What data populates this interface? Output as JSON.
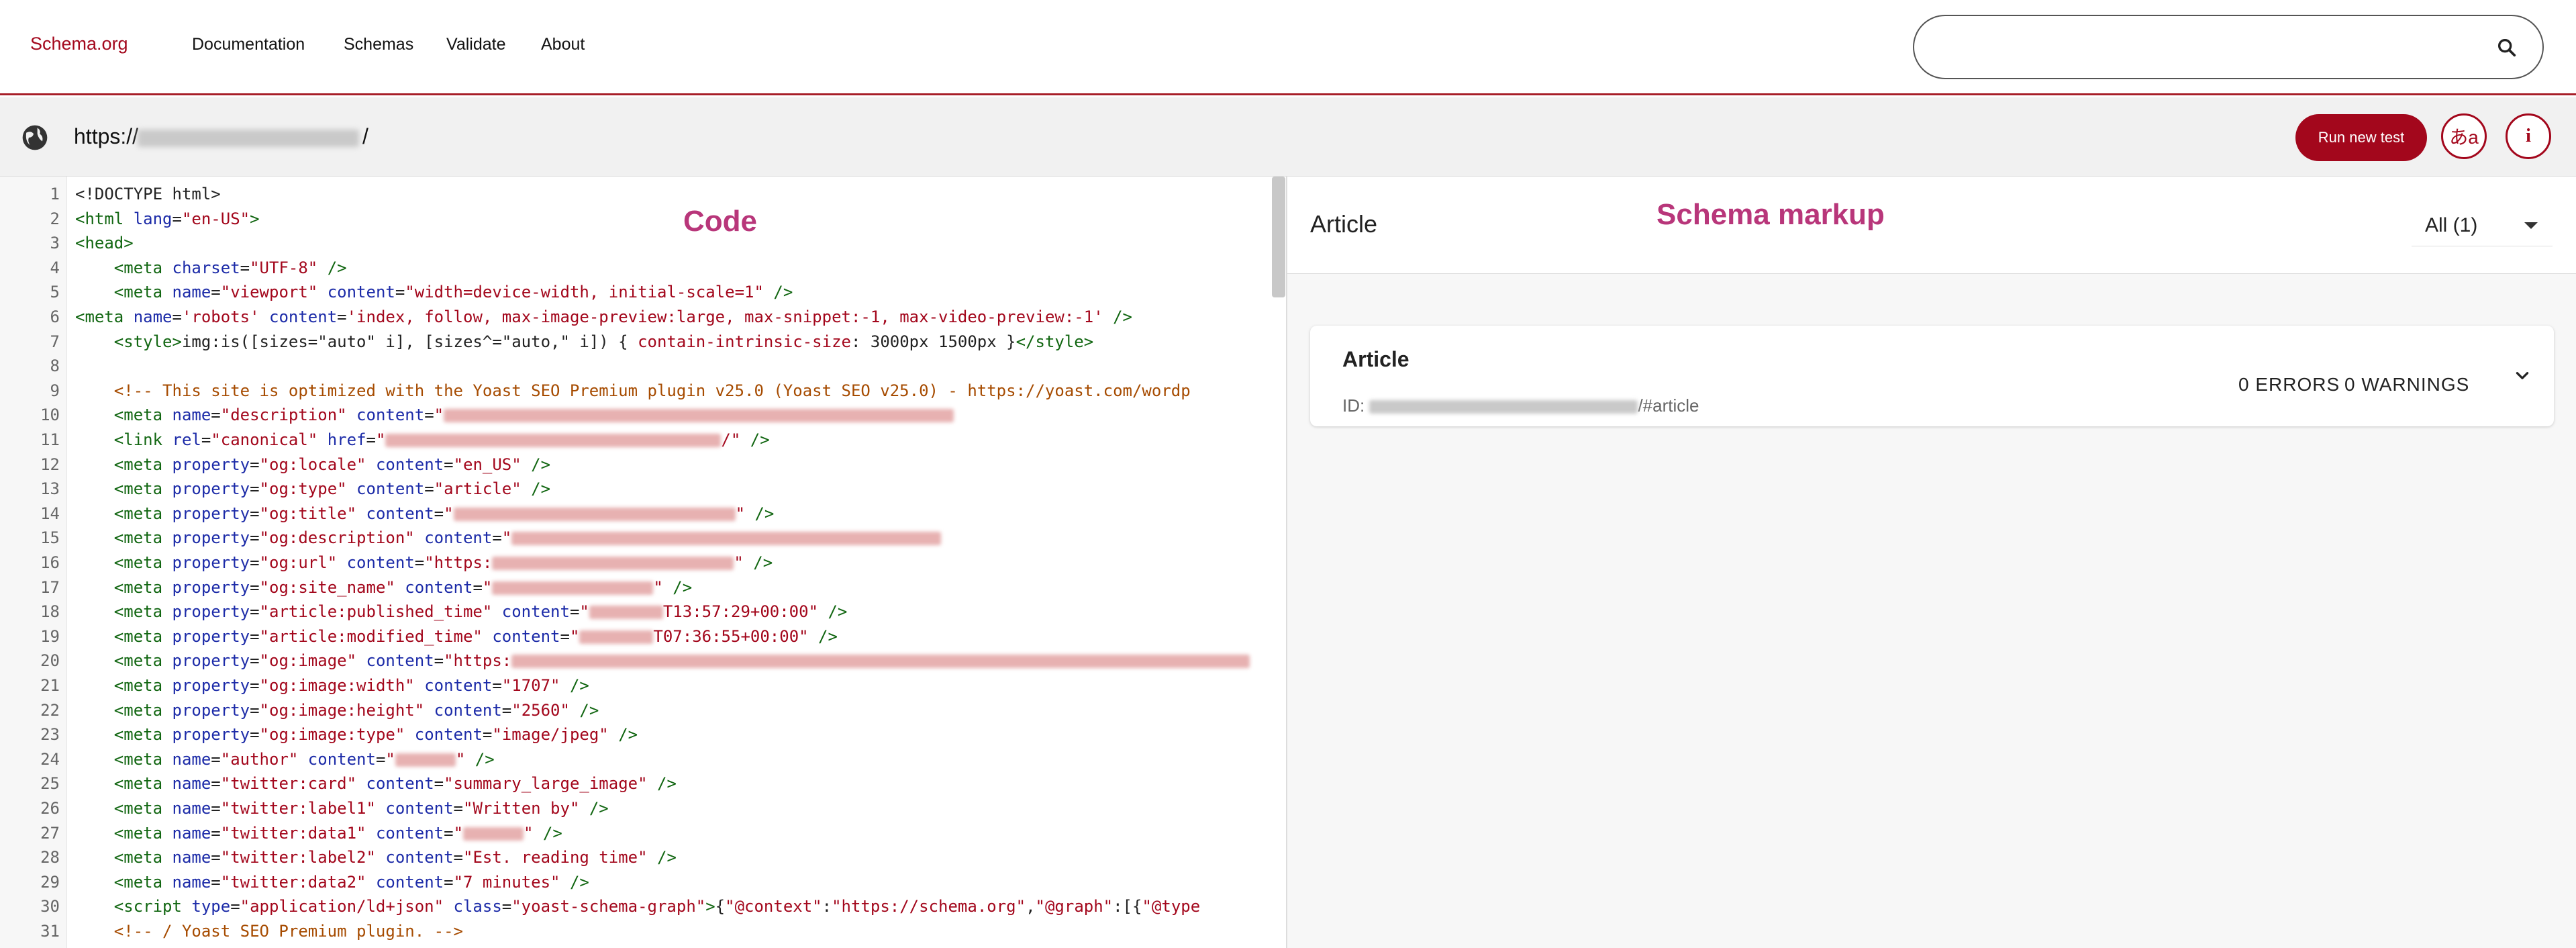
{
  "nav": {
    "logo": "Schema.org",
    "links": [
      "Documentation",
      "Schemas",
      "Validate",
      "About"
    ]
  },
  "urlbar": {
    "prefix": "https://",
    "suffix": "/",
    "run_label": "Run new test",
    "lang_label": "あa",
    "info_label": "i"
  },
  "code": {
    "panel_label": "Code",
    "lines": [
      [
        [
          "t",
          "<!DOCTYPE html>"
        ]
      ],
      [
        [
          "g",
          "<html "
        ],
        [
          "a",
          "lang"
        ],
        [
          "t",
          "="
        ],
        [
          "s",
          "\"en-US\""
        ],
        [
          "g",
          ">"
        ]
      ],
      [
        [
          "g",
          "<head>"
        ]
      ],
      [
        [
          "t",
          "    "
        ],
        [
          "g",
          "<meta "
        ],
        [
          "a",
          "charset"
        ],
        [
          "t",
          "="
        ],
        [
          "s",
          "\"UTF-8\""
        ],
        [
          "g",
          " />"
        ]
      ],
      [
        [
          "t",
          "    "
        ],
        [
          "g",
          "<meta "
        ],
        [
          "a",
          "name"
        ],
        [
          "t",
          "="
        ],
        [
          "s",
          "\"viewport\""
        ],
        [
          "t",
          " "
        ],
        [
          "a",
          "content"
        ],
        [
          "t",
          "="
        ],
        [
          "s",
          "\"width=device-width, initial-scale=1\""
        ],
        [
          "g",
          " />"
        ]
      ],
      [
        [
          "g",
          "<meta "
        ],
        [
          "a",
          "name"
        ],
        [
          "t",
          "="
        ],
        [
          "s",
          "'robots'"
        ],
        [
          "t",
          " "
        ],
        [
          "a",
          "content"
        ],
        [
          "t",
          "="
        ],
        [
          "s",
          "'index, follow, max-image-preview:large, max-snippet:-1, max-video-preview:-1'"
        ],
        [
          "g",
          " />"
        ]
      ],
      [
        [
          "t",
          "    "
        ],
        [
          "g",
          "<style>"
        ],
        [
          "t",
          "img:is([sizes=\"auto\" i], [sizes^=\"auto,\" i]) { "
        ],
        [
          "s",
          "contain-intrinsic-size"
        ],
        [
          "t",
          ": 3000px 1500px }"
        ],
        [
          "g",
          "</style>"
        ]
      ],
      [],
      [
        [
          "t",
          "    "
        ],
        [
          "c",
          "<!-- This site is optimized with the Yoast SEO Premium plugin v25.0 (Yoast SEO v25.0) - https://yoast.com/wordp"
        ]
      ],
      [
        [
          "t",
          "    "
        ],
        [
          "g",
          "<meta "
        ],
        [
          "a",
          "name"
        ],
        [
          "t",
          "="
        ],
        [
          "s",
          "\"description\""
        ],
        [
          "t",
          " "
        ],
        [
          "a",
          "content"
        ],
        [
          "t",
          "="
        ],
        [
          "s",
          "\""
        ],
        [
          "b",
          "760"
        ]
      ],
      [
        [
          "t",
          "    "
        ],
        [
          "g",
          "<link "
        ],
        [
          "a",
          "rel"
        ],
        [
          "t",
          "="
        ],
        [
          "s",
          "\"canonical\""
        ],
        [
          "t",
          " "
        ],
        [
          "a",
          "href"
        ],
        [
          "t",
          "="
        ],
        [
          "s",
          "\""
        ],
        [
          "b",
          "500"
        ],
        [
          "s",
          "/\""
        ],
        [
          "g",
          " />"
        ]
      ],
      [
        [
          "t",
          "    "
        ],
        [
          "g",
          "<meta "
        ],
        [
          "a",
          "property"
        ],
        [
          "t",
          "="
        ],
        [
          "s",
          "\"og:locale\""
        ],
        [
          "t",
          " "
        ],
        [
          "a",
          "content"
        ],
        [
          "t",
          "="
        ],
        [
          "s",
          "\"en_US\""
        ],
        [
          "g",
          " />"
        ]
      ],
      [
        [
          "t",
          "    "
        ],
        [
          "g",
          "<meta "
        ],
        [
          "a",
          "property"
        ],
        [
          "t",
          "="
        ],
        [
          "s",
          "\"og:type\""
        ],
        [
          "t",
          " "
        ],
        [
          "a",
          "content"
        ],
        [
          "t",
          "="
        ],
        [
          "s",
          "\"article\""
        ],
        [
          "g",
          " />"
        ]
      ],
      [
        [
          "t",
          "    "
        ],
        [
          "g",
          "<meta "
        ],
        [
          "a",
          "property"
        ],
        [
          "t",
          "="
        ],
        [
          "s",
          "\"og:title\""
        ],
        [
          "t",
          " "
        ],
        [
          "a",
          "content"
        ],
        [
          "t",
          "="
        ],
        [
          "s",
          "\""
        ],
        [
          "b",
          "420"
        ],
        [
          "s",
          "\""
        ],
        [
          "g",
          " />"
        ]
      ],
      [
        [
          "t",
          "    "
        ],
        [
          "g",
          "<meta "
        ],
        [
          "a",
          "property"
        ],
        [
          "t",
          "="
        ],
        [
          "s",
          "\"og:description\""
        ],
        [
          "t",
          " "
        ],
        [
          "a",
          "content"
        ],
        [
          "t",
          "="
        ],
        [
          "s",
          "\""
        ],
        [
          "b",
          "640"
        ]
      ],
      [
        [
          "t",
          "    "
        ],
        [
          "g",
          "<meta "
        ],
        [
          "a",
          "property"
        ],
        [
          "t",
          "="
        ],
        [
          "s",
          "\"og:url\""
        ],
        [
          "t",
          " "
        ],
        [
          "a",
          "content"
        ],
        [
          "t",
          "="
        ],
        [
          "s",
          "\"https:"
        ],
        [
          "b",
          "360"
        ],
        [
          "s",
          "\""
        ],
        [
          "g",
          " />"
        ]
      ],
      [
        [
          "t",
          "    "
        ],
        [
          "g",
          "<meta "
        ],
        [
          "a",
          "property"
        ],
        [
          "t",
          "="
        ],
        [
          "s",
          "\"og:site_name\""
        ],
        [
          "t",
          " "
        ],
        [
          "a",
          "content"
        ],
        [
          "t",
          "="
        ],
        [
          "s",
          "\""
        ],
        [
          "b",
          "240"
        ],
        [
          "s",
          "\""
        ],
        [
          "g",
          " />"
        ]
      ],
      [
        [
          "t",
          "    "
        ],
        [
          "g",
          "<meta "
        ],
        [
          "a",
          "property"
        ],
        [
          "t",
          "="
        ],
        [
          "s",
          "\"article:published_time\""
        ],
        [
          "t",
          " "
        ],
        [
          "a",
          "content"
        ],
        [
          "t",
          "="
        ],
        [
          "s",
          "\""
        ],
        [
          "b",
          "110"
        ],
        [
          "s",
          "T13:57:29+00:00\""
        ],
        [
          "g",
          " />"
        ]
      ],
      [
        [
          "t",
          "    "
        ],
        [
          "g",
          "<meta "
        ],
        [
          "a",
          "property"
        ],
        [
          "t",
          "="
        ],
        [
          "s",
          "\"article:modified_time\""
        ],
        [
          "t",
          " "
        ],
        [
          "a",
          "content"
        ],
        [
          "t",
          "="
        ],
        [
          "s",
          "\""
        ],
        [
          "b",
          "110"
        ],
        [
          "s",
          "T07:36:55+00:00\""
        ],
        [
          "g",
          " />"
        ]
      ],
      [
        [
          "t",
          "    "
        ],
        [
          "g",
          "<meta "
        ],
        [
          "a",
          "property"
        ],
        [
          "t",
          "="
        ],
        [
          "s",
          "\"og:image\""
        ],
        [
          "t",
          " "
        ],
        [
          "a",
          "content"
        ],
        [
          "t",
          "="
        ],
        [
          "s",
          "\"https:"
        ],
        [
          "b",
          "1100"
        ]
      ],
      [
        [
          "t",
          "    "
        ],
        [
          "g",
          "<meta "
        ],
        [
          "a",
          "property"
        ],
        [
          "t",
          "="
        ],
        [
          "s",
          "\"og:image:width\""
        ],
        [
          "t",
          " "
        ],
        [
          "a",
          "content"
        ],
        [
          "t",
          "="
        ],
        [
          "s",
          "\"1707\""
        ],
        [
          "g",
          " />"
        ]
      ],
      [
        [
          "t",
          "    "
        ],
        [
          "g",
          "<meta "
        ],
        [
          "a",
          "property"
        ],
        [
          "t",
          "="
        ],
        [
          "s",
          "\"og:image:height\""
        ],
        [
          "t",
          " "
        ],
        [
          "a",
          "content"
        ],
        [
          "t",
          "="
        ],
        [
          "s",
          "\"2560\""
        ],
        [
          "g",
          " />"
        ]
      ],
      [
        [
          "t",
          "    "
        ],
        [
          "g",
          "<meta "
        ],
        [
          "a",
          "property"
        ],
        [
          "t",
          "="
        ],
        [
          "s",
          "\"og:image:type\""
        ],
        [
          "t",
          " "
        ],
        [
          "a",
          "content"
        ],
        [
          "t",
          "="
        ],
        [
          "s",
          "\"image/jpeg\""
        ],
        [
          "g",
          " />"
        ]
      ],
      [
        [
          "t",
          "    "
        ],
        [
          "g",
          "<meta "
        ],
        [
          "a",
          "name"
        ],
        [
          "t",
          "="
        ],
        [
          "s",
          "\"author\""
        ],
        [
          "t",
          " "
        ],
        [
          "a",
          "content"
        ],
        [
          "t",
          "="
        ],
        [
          "s",
          "\""
        ],
        [
          "b",
          "90"
        ],
        [
          "s",
          "\""
        ],
        [
          "g",
          " />"
        ]
      ],
      [
        [
          "t",
          "    "
        ],
        [
          "g",
          "<meta "
        ],
        [
          "a",
          "name"
        ],
        [
          "t",
          "="
        ],
        [
          "s",
          "\"twitter:card\""
        ],
        [
          "t",
          " "
        ],
        [
          "a",
          "content"
        ],
        [
          "t",
          "="
        ],
        [
          "s",
          "\"summary_large_image\""
        ],
        [
          "g",
          " />"
        ]
      ],
      [
        [
          "t",
          "    "
        ],
        [
          "g",
          "<meta "
        ],
        [
          "a",
          "name"
        ],
        [
          "t",
          "="
        ],
        [
          "s",
          "\"twitter:label1\""
        ],
        [
          "t",
          " "
        ],
        [
          "a",
          "content"
        ],
        [
          "t",
          "="
        ],
        [
          "s",
          "\"Written by\""
        ],
        [
          "g",
          " />"
        ]
      ],
      [
        [
          "t",
          "    "
        ],
        [
          "g",
          "<meta "
        ],
        [
          "a",
          "name"
        ],
        [
          "t",
          "="
        ],
        [
          "s",
          "\"twitter:data1\""
        ],
        [
          "t",
          " "
        ],
        [
          "a",
          "content"
        ],
        [
          "t",
          "="
        ],
        [
          "s",
          "\""
        ],
        [
          "b",
          "90"
        ],
        [
          "s",
          "\""
        ],
        [
          "g",
          " />"
        ]
      ],
      [
        [
          "t",
          "    "
        ],
        [
          "g",
          "<meta "
        ],
        [
          "a",
          "name"
        ],
        [
          "t",
          "="
        ],
        [
          "s",
          "\"twitter:label2\""
        ],
        [
          "t",
          " "
        ],
        [
          "a",
          "content"
        ],
        [
          "t",
          "="
        ],
        [
          "s",
          "\"Est. reading time\""
        ],
        [
          "g",
          " />"
        ]
      ],
      [
        [
          "t",
          "    "
        ],
        [
          "g",
          "<meta "
        ],
        [
          "a",
          "name"
        ],
        [
          "t",
          "="
        ],
        [
          "s",
          "\"twitter:data2\""
        ],
        [
          "t",
          " "
        ],
        [
          "a",
          "content"
        ],
        [
          "t",
          "="
        ],
        [
          "s",
          "\"7 minutes\""
        ],
        [
          "g",
          " />"
        ]
      ],
      [
        [
          "t",
          "    "
        ],
        [
          "g",
          "<script "
        ],
        [
          "a",
          "type"
        ],
        [
          "t",
          "="
        ],
        [
          "s",
          "\"application/ld+json\""
        ],
        [
          "t",
          " "
        ],
        [
          "a",
          "class"
        ],
        [
          "t",
          "="
        ],
        [
          "s",
          "\"yoast-schema-graph\""
        ],
        [
          "g",
          ">"
        ],
        [
          "t",
          "{"
        ],
        [
          "s",
          "\"@context\""
        ],
        [
          "t",
          ":"
        ],
        [
          "s",
          "\"https://schema.org\""
        ],
        [
          "t",
          ","
        ],
        [
          "s",
          "\"@graph\""
        ],
        [
          "t",
          ":[{"
        ],
        [
          "s",
          "\"@type"
        ]
      ],
      [
        [
          "t",
          "    "
        ],
        [
          "c",
          "<!-- / Yoast SEO Premium plugin. -->"
        ]
      ]
    ]
  },
  "schema": {
    "panel_label": "Schema markup",
    "header_title": "Article",
    "filter_label": "All (1)",
    "card": {
      "title": "Article",
      "id_prefix": "ID: ",
      "id_suffix": "/#article",
      "errors": "0 ERRORS",
      "warnings": "0 WARNINGS"
    }
  }
}
